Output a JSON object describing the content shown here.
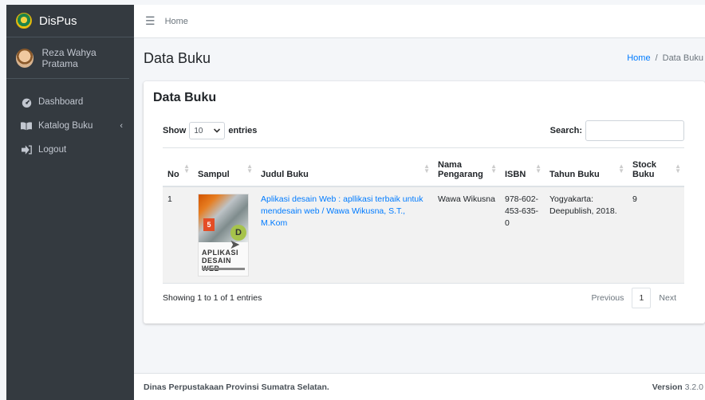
{
  "brand": {
    "name": "DisPus"
  },
  "user": {
    "name": "Reza Wahya Pratama"
  },
  "sidebar": {
    "items": [
      {
        "label": "Dashboard",
        "icon": "dashboard-icon"
      },
      {
        "label": "Katalog Buku",
        "icon": "book-icon",
        "chevron": "‹"
      },
      {
        "label": "Logout",
        "icon": "logout-icon"
      }
    ]
  },
  "topbar": {
    "menu_icon": "☰",
    "home_label": "Home"
  },
  "header": {
    "title": "Data Buku",
    "breadcrumb_home": "Home",
    "breadcrumb_sep": "/",
    "breadcrumb_current": "Data Buku"
  },
  "card": {
    "title": "Data Buku"
  },
  "datatable": {
    "show_label": "Show",
    "length_value": "10",
    "entries_label": "entries",
    "search_label": "Search:",
    "search_value": "",
    "columns": [
      "No",
      "Sampul",
      "Judul Buku",
      "Nama Pengarang",
      "ISBN",
      "Tahun Buku",
      "Stock Buku"
    ],
    "rows": [
      {
        "no": "1",
        "cover_title": "APLIKASI DESAIN WEB",
        "judul": "Aplikasi desain Web : apllikasi terbaik untuk mendesain web / Wawa Wikusna, S.T., M.Kom",
        "pengarang": "Wawa Wikusna",
        "isbn": "978-602-453-635-0",
        "tahun": "Yogyakarta: Deepublish, 2018.",
        "stock": "9"
      }
    ],
    "info": "Showing 1 to 1 of 1 entries",
    "prev_label": "Previous",
    "page": "1",
    "next_label": "Next"
  },
  "footer": {
    "text": "Dinas Perpustakaan Provinsi Sumatra Selatan.",
    "version_label": "Version",
    "version_value": "3.2.0"
  },
  "colors": {
    "sidebar_bg": "#343a40",
    "link": "#007bff",
    "content_bg": "#f4f6f9"
  }
}
